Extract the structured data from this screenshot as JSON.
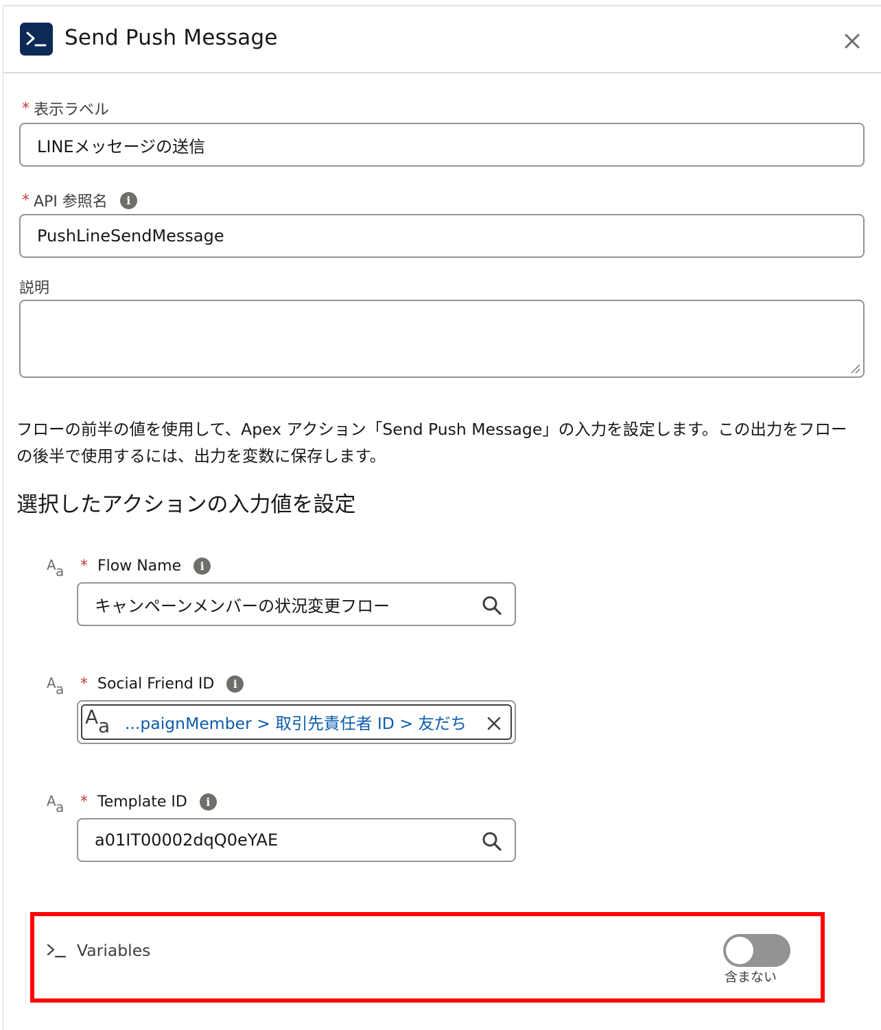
{
  "header": {
    "title": "Send Push Message"
  },
  "form": {
    "label_field": {
      "label": "表示ラベル",
      "required_mark": "*",
      "value": "LINEメッセージの送信"
    },
    "api_name_field": {
      "label": "API 参照名",
      "required_mark": "*",
      "value": "PushLineSendMessage"
    },
    "description_field": {
      "label": "説明",
      "value": ""
    }
  },
  "help_text": "フローの前半の値を使用して、Apex アクション「Send Push Message」の入力を設定します。この出力をフローの後半で使用するには、出力を変数に保存します。",
  "section_title": "選択したアクションの入力値を設定",
  "inputs": {
    "flow_name": {
      "type_icon_big": "A",
      "type_icon_small": "a",
      "required_mark": "*",
      "label": "Flow Name",
      "value": "キャンペーンメンバーの状況変更フロー"
    },
    "social_friend_id": {
      "type_icon_big": "A",
      "type_icon_small": "a",
      "required_mark": "*",
      "label": "Social Friend ID",
      "pill_text": "...paignMember > 取引先責任者 ID > 友だち"
    },
    "template_id": {
      "type_icon_big": "A",
      "type_icon_small": "a",
      "required_mark": "*",
      "label": "Template ID",
      "value": "a01IT00002dqQ0eYAE"
    }
  },
  "variables": {
    "label": "Variables",
    "toggle_state_label": "含まない",
    "toggle_on": false
  },
  "icons": {
    "header_icon": "apex-terminal-icon",
    "close": "close-icon",
    "info": "info-icon",
    "info_glyph": "i",
    "search": "search-icon",
    "remove": "remove-icon",
    "variables": "terminal-icon"
  },
  "colors": {
    "header_icon_bg": "#0d2a57",
    "required": "#c23934",
    "pill_text": "#0b5cab",
    "highlight_border": "#ff0000",
    "toggle_off": "#939393"
  }
}
